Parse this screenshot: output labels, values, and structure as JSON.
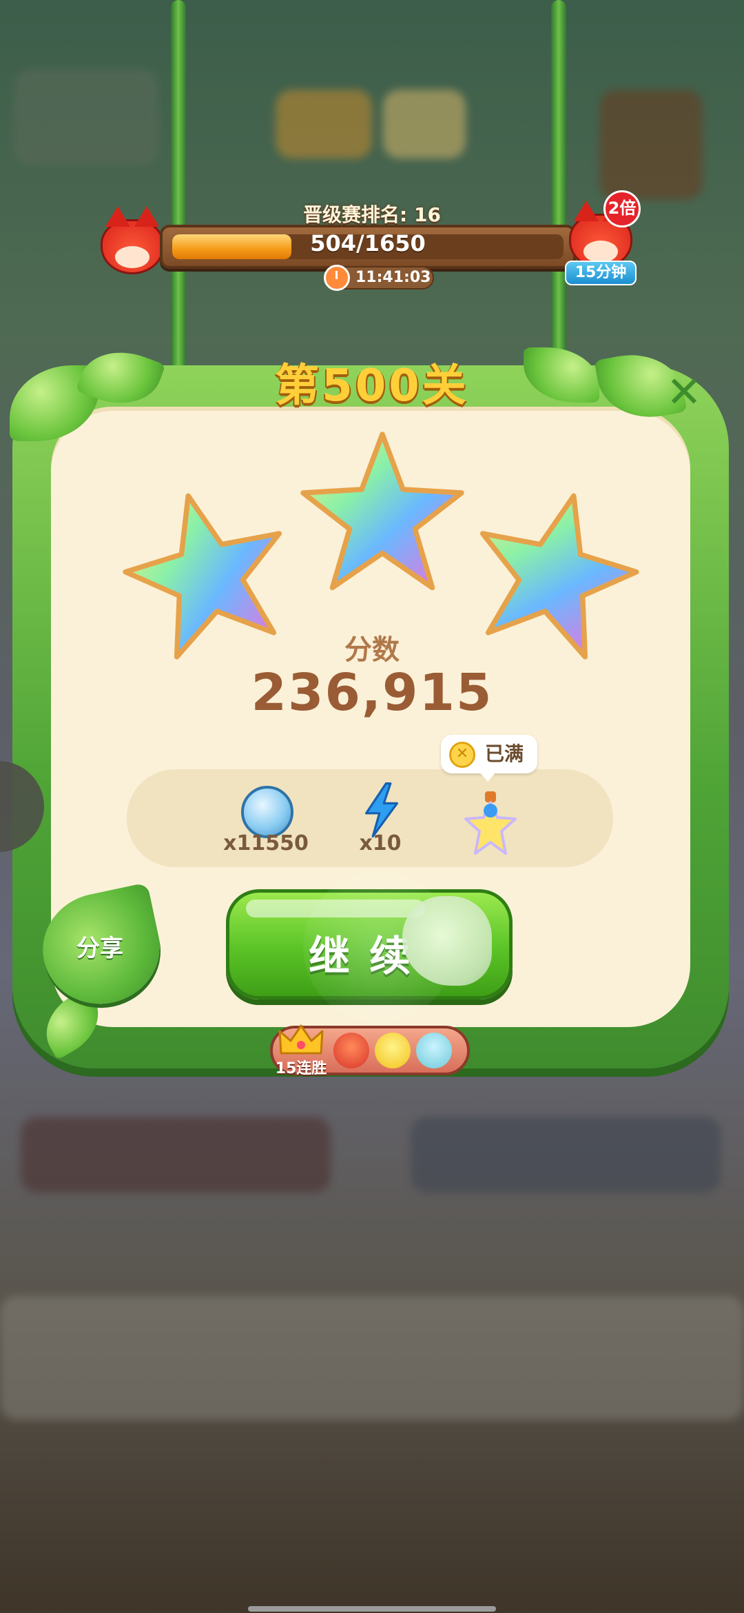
{
  "header": {
    "rank_text": "晋级赛排名: 16",
    "progress": {
      "current": 504,
      "total": 1650,
      "label": "504/1650",
      "fraction": 0.305
    },
    "timer": "11:41:03",
    "bonus_multiplier": "2倍",
    "bonus_duration": "15分钟"
  },
  "panel": {
    "title": "第500关",
    "close_label": "✕",
    "stars_earned": 3,
    "score_label": "分数",
    "score_value": "236,915"
  },
  "rewards": [
    {
      "icon": "coin-icon",
      "count": "x11550"
    },
    {
      "icon": "lightning-icon",
      "count": "x10"
    },
    {
      "icon": "star-bottle-icon",
      "status": "已满"
    }
  ],
  "buttons": {
    "share": "分享",
    "continue": "继续"
  },
  "streak": {
    "label": "15连胜"
  },
  "colors": {
    "panel_green": "#4fa436",
    "panel_cream": "#fbf1d8",
    "continue_green": "#5ac326",
    "score_brown": "#9a5c35",
    "title_gold": "#ffcf3a"
  }
}
